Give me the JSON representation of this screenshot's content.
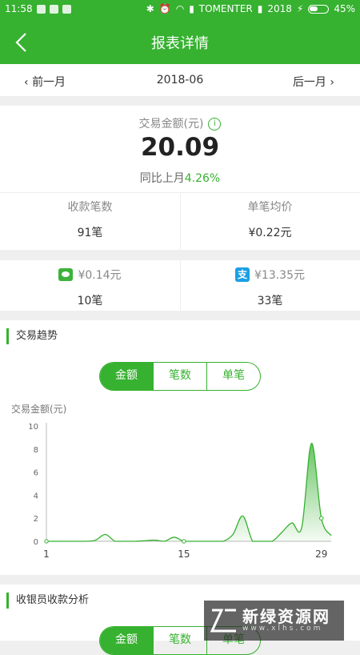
{
  "status_bar": {
    "time": "11:58",
    "carrier": "TOMENTER",
    "year": "2018",
    "battery": "45%"
  },
  "header": {
    "title": "报表详情"
  },
  "month_nav": {
    "prev": "前一月",
    "current": "2018-06",
    "next": "后一月"
  },
  "summary": {
    "label": "交易金额(元)",
    "amount": "20.09",
    "yoy_label": "同比上月",
    "yoy_value": "4.26%",
    "count_label": "收款笔数",
    "count_value": "91笔",
    "avg_label": "单笔均价",
    "avg_value": "¥0.22元"
  },
  "payments": {
    "wechat": {
      "amount": "¥0.14元",
      "count": "10笔",
      "icon": "wechat-pay-icon"
    },
    "alipay": {
      "amount": "¥13.35元",
      "count": "33笔",
      "icon": "alipay-icon",
      "glyph": "支"
    }
  },
  "trend": {
    "title": "交易趋势",
    "tabs": [
      "金额",
      "笔数",
      "单笔"
    ],
    "active_tab": "金额",
    "ylabel": "交易金额(元)"
  },
  "chart_data": {
    "type": "area",
    "x": [
      1,
      2,
      3,
      4,
      5,
      6,
      7,
      8,
      9,
      10,
      11,
      12,
      13,
      14,
      15,
      16,
      17,
      18,
      19,
      20,
      21,
      22,
      23,
      24,
      25,
      26,
      27,
      28,
      29,
      30
    ],
    "values": [
      0,
      0,
      0,
      0,
      0,
      0.1,
      0.6,
      0,
      0,
      0,
      0.05,
      0.1,
      0,
      0.35,
      0,
      0,
      0,
      0,
      0,
      0.6,
      2.2,
      0,
      0,
      0,
      0.8,
      1.6,
      1.2,
      8.5,
      2,
      0.5
    ],
    "x_ticks": [
      1,
      15,
      29
    ],
    "y_ticks": [
      0,
      2,
      4,
      6,
      8,
      10
    ],
    "ylim": [
      0,
      10
    ],
    "color": "#36b130"
  },
  "cashier": {
    "title": "收银员收款分析",
    "tabs": [
      "金额",
      "笔数",
      "单笔"
    ]
  },
  "watermark": {
    "text": "新绿资源网",
    "url": "www.xlhs.com"
  }
}
